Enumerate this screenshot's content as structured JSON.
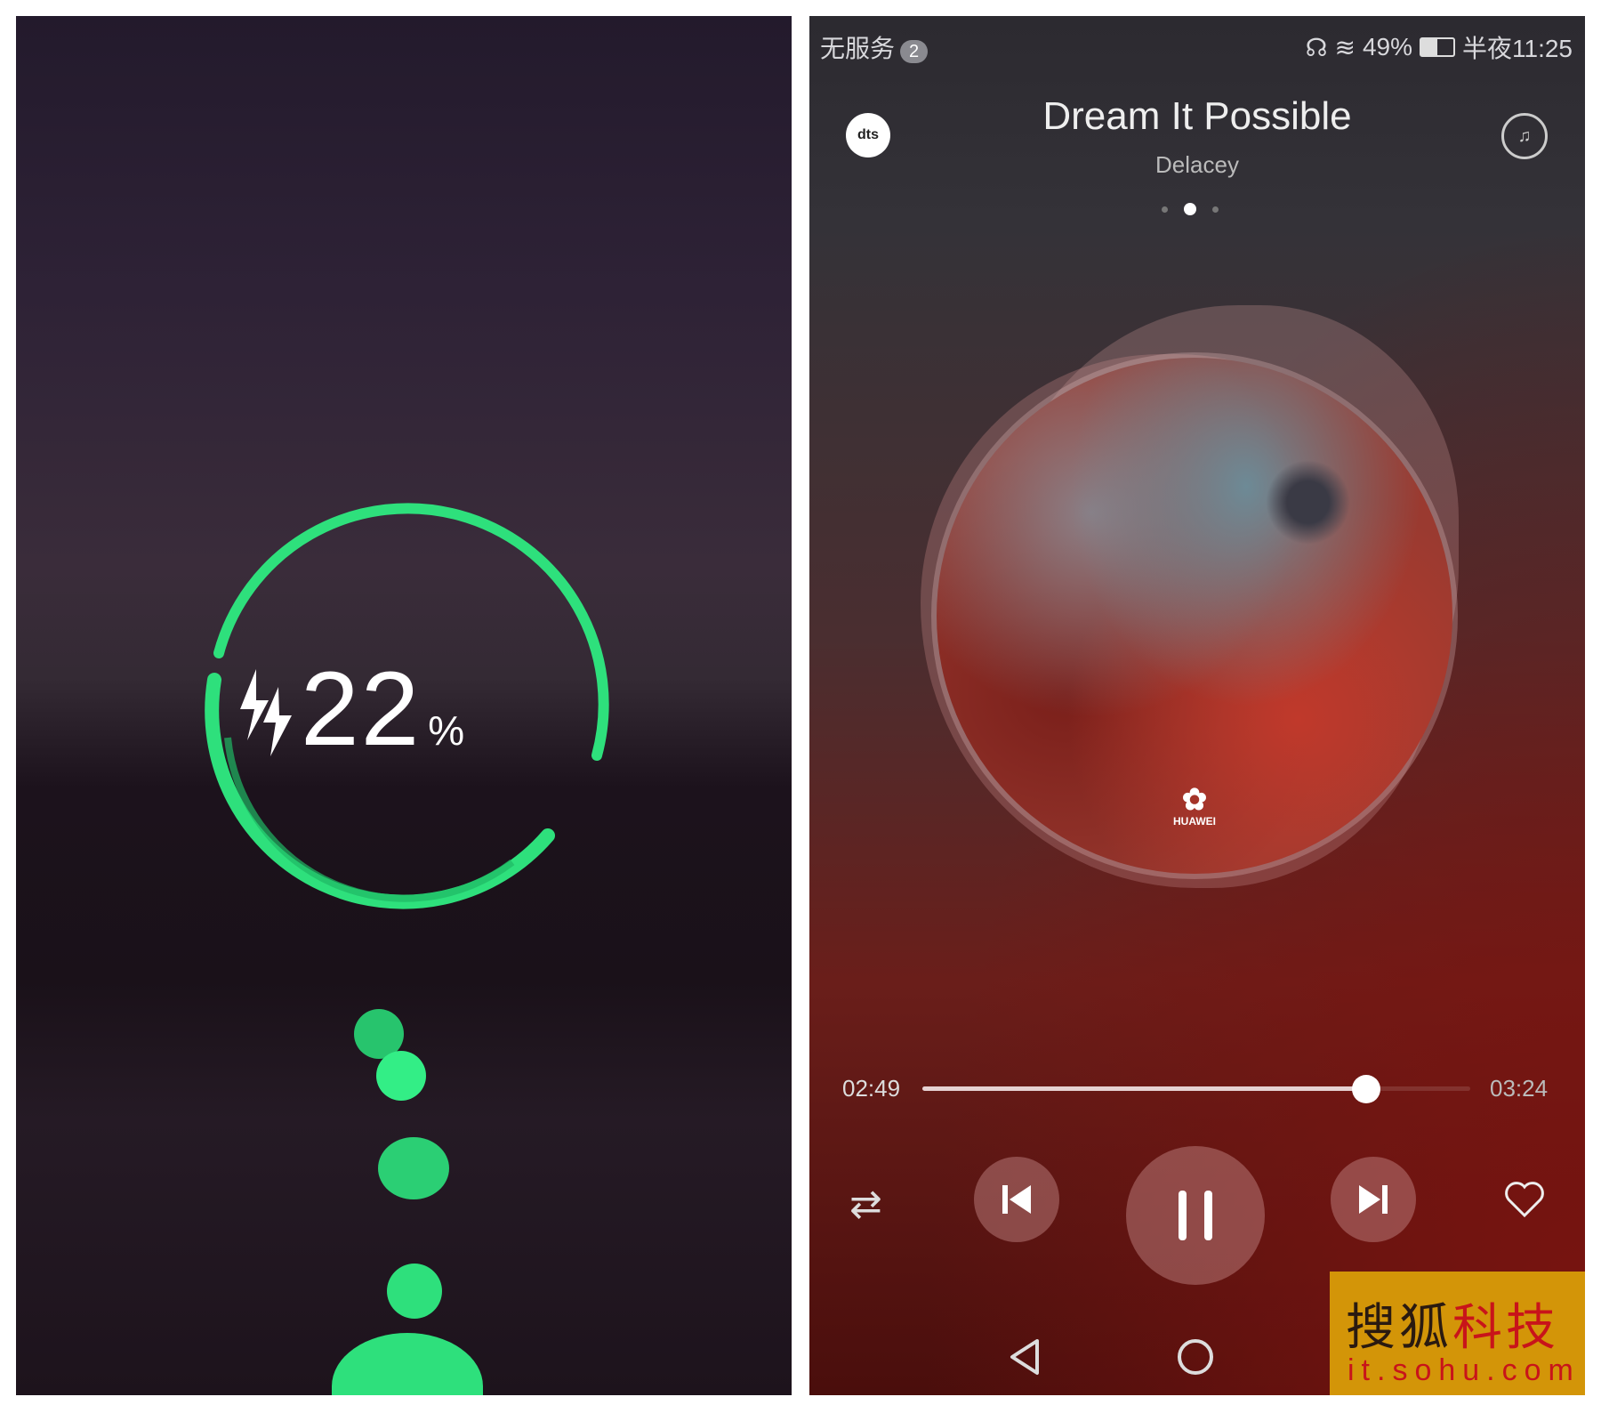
{
  "charging_screen": {
    "percent": "22",
    "unit": "%",
    "ring_color": "#2ee07c",
    "icon": "lightning-bolt-icon"
  },
  "status_bar": {
    "carrier": "无服务",
    "sim_badge": "2",
    "battery": "49%",
    "time": "半夜11:25",
    "icons": [
      "headset-icon",
      "wifi-icon",
      "data-icon",
      "battery-icon"
    ]
  },
  "player": {
    "title": "Dream It Possible",
    "artist": "Delacey",
    "page_indicator": {
      "count": 3,
      "active": 1
    },
    "album_logo": "HUAWEI",
    "elapsed": "02:49",
    "duration": "03:24",
    "progress": 0.81,
    "left_button": "dts-icon",
    "right_button": "sound-effect-icon",
    "controls": [
      "shuffle-icon",
      "previous-icon",
      "pause-icon",
      "next-icon",
      "heart-icon"
    ]
  },
  "watermark": {
    "name": "搜狐科技",
    "url": "it.sohu.com"
  }
}
